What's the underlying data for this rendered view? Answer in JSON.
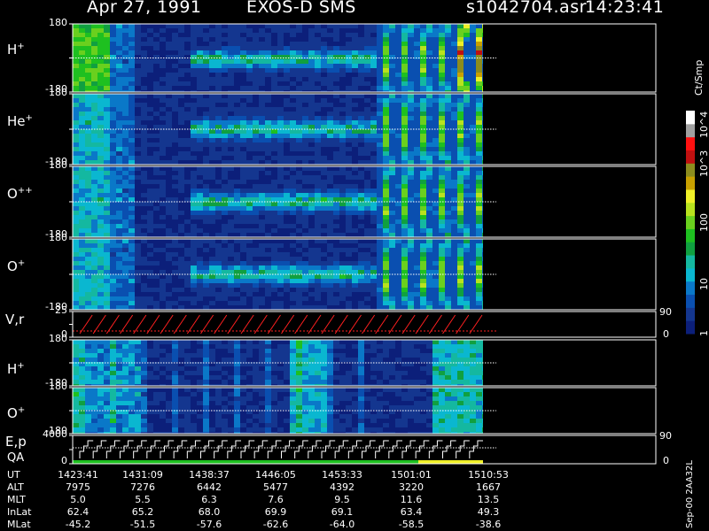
{
  "header": {
    "date": "Apr 27, 1991",
    "mission": "EXOS-D SMS",
    "file": "s1042704.asr",
    "time": "14:23:41"
  },
  "colorbar": {
    "label": "Ct/Smp",
    "ticks": [
      "1",
      "10",
      "100",
      "10^3",
      "10^4"
    ],
    "colors": [
      "#0c1f7a",
      "#14368f",
      "#0a4fb0",
      "#0a78c8",
      "#0ab7d0",
      "#14b8a0",
      "#10a040",
      "#1ec020",
      "#6ad01e",
      "#b8e21e",
      "#f0f028",
      "#c8a000",
      "#8c8c1e",
      "#c01010",
      "#ff1010",
      "#a0a0a0",
      "#ffffff"
    ]
  },
  "chart_data": {
    "type": "heatmap",
    "title": "Apr 27, 1991 EXOS-D SMS",
    "panels": [
      {
        "label": "H",
        "charge": "+",
        "ymin": "-180",
        "ymax": "180"
      },
      {
        "label": "He",
        "charge": "+",
        "ymin": "-180",
        "ymax": "180"
      },
      {
        "label": "O",
        "charge": "++",
        "ymin": "-180",
        "ymax": "180"
      },
      {
        "label": "O",
        "charge": "+",
        "ymin": "-180",
        "ymax": "180"
      },
      {
        "label": "V,r",
        "charge": "",
        "ymin": "0",
        "ymax": "25",
        "right_top": "90",
        "right_bottom": "0"
      },
      {
        "label": "H",
        "charge": "+",
        "ymin": "-180",
        "ymax": "180"
      },
      {
        "label": "O",
        "charge": "+",
        "ymin": "-180",
        "ymax": "180"
      },
      {
        "label": "E,p",
        "sublabel": "QA",
        "charge": "",
        "ymin": "0",
        "ymax": "4000",
        "right_top": "90",
        "right_bottom": "0"
      }
    ],
    "ephemeris": {
      "rows": [
        {
          "name": "UT",
          "values": [
            "1423:41",
            "1431:09",
            "1438:37",
            "1446:05",
            "1453:33",
            "1501:01",
            "1510:53"
          ]
        },
        {
          "name": "ALT",
          "values": [
            "7975",
            "7276",
            "6442",
            "5477",
            "4392",
            "3220",
            "1667"
          ]
        },
        {
          "name": "MLT",
          "values": [
            "5.0",
            "5.5",
            "6.3",
            "7.6",
            "9.5",
            "11.6",
            "13.5"
          ]
        },
        {
          "name": "InLat",
          "values": [
            "62.4",
            "65.2",
            "68.0",
            "69.9",
            "69.1",
            "63.4",
            "49.3"
          ]
        },
        {
          "name": "MLat",
          "values": [
            "-45.2",
            "-51.5",
            "-57.6",
            "-62.6",
            "-64.0",
            "-58.5",
            "-38.6"
          ]
        }
      ]
    }
  },
  "footer": "Sep-00 2AA32L"
}
